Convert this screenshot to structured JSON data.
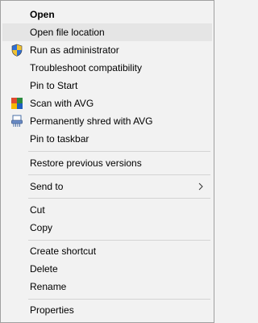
{
  "menu": {
    "open": "Open",
    "open_file_location": "Open file location",
    "run_as_admin": "Run as administrator",
    "troubleshoot": "Troubleshoot compatibility",
    "pin_to_start": "Pin to Start",
    "scan_avg": "Scan with AVG",
    "shred_avg": "Permanently shred with AVG",
    "pin_to_taskbar": "Pin to taskbar",
    "restore_versions": "Restore previous versions",
    "send_to": "Send to",
    "cut": "Cut",
    "copy": "Copy",
    "create_shortcut": "Create shortcut",
    "delete": "Delete",
    "rename": "Rename",
    "properties": "Properties"
  },
  "icons": {
    "run_as_admin": "uac-shield-icon",
    "scan_avg": "avg-scan-icon",
    "shred_avg": "avg-shred-icon",
    "send_to": "chevron-right-icon"
  },
  "colors": {
    "menu_bg": "#f2f2f2",
    "hover_bg": "#e5e5e5",
    "border": "#a0a0a0",
    "separator": "#d4d4d4"
  }
}
